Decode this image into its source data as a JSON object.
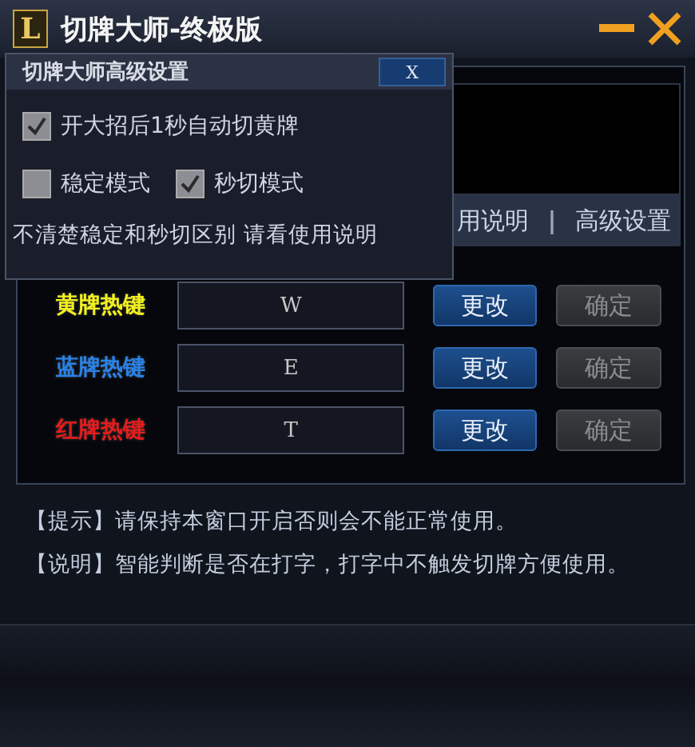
{
  "window": {
    "logo": "L",
    "title": "切牌大师-终极版"
  },
  "links": [
    {
      "kind": "link",
      "text": "用说明"
    },
    {
      "kind": "separator",
      "text": "|"
    },
    {
      "kind": "link",
      "text": "高级设置"
    }
  ],
  "hotkeys": [
    {
      "label": "黄牌热键",
      "color": "#f2f01e",
      "key": "W",
      "change": "更改",
      "confirm": "确定",
      "confirm_disabled": true
    },
    {
      "label": "蓝牌热键",
      "color": "#2a82e6",
      "key": "E",
      "change": "更改",
      "confirm": "确定",
      "confirm_disabled": true
    },
    {
      "label": "红牌热键",
      "color": "#e41c1c",
      "key": "T",
      "change": "更改",
      "confirm": "确定",
      "confirm_disabled": true
    }
  ],
  "tips": [
    "【提示】请保持本窗口开启否则会不能正常使用。",
    "【说明】智能判断是否在打字，打字中不触发切牌方便使用。"
  ],
  "dialog": {
    "title": "切牌大师高级设置",
    "close": "X",
    "options": [
      [
        {
          "label": "开大招后1秒自动切黄牌",
          "checked": true
        }
      ],
      [
        {
          "label": "稳定模式",
          "checked": false
        },
        {
          "label": "秒切模式",
          "checked": true
        }
      ]
    ],
    "note": "不清楚稳定和秒切区别 请看使用说明"
  }
}
